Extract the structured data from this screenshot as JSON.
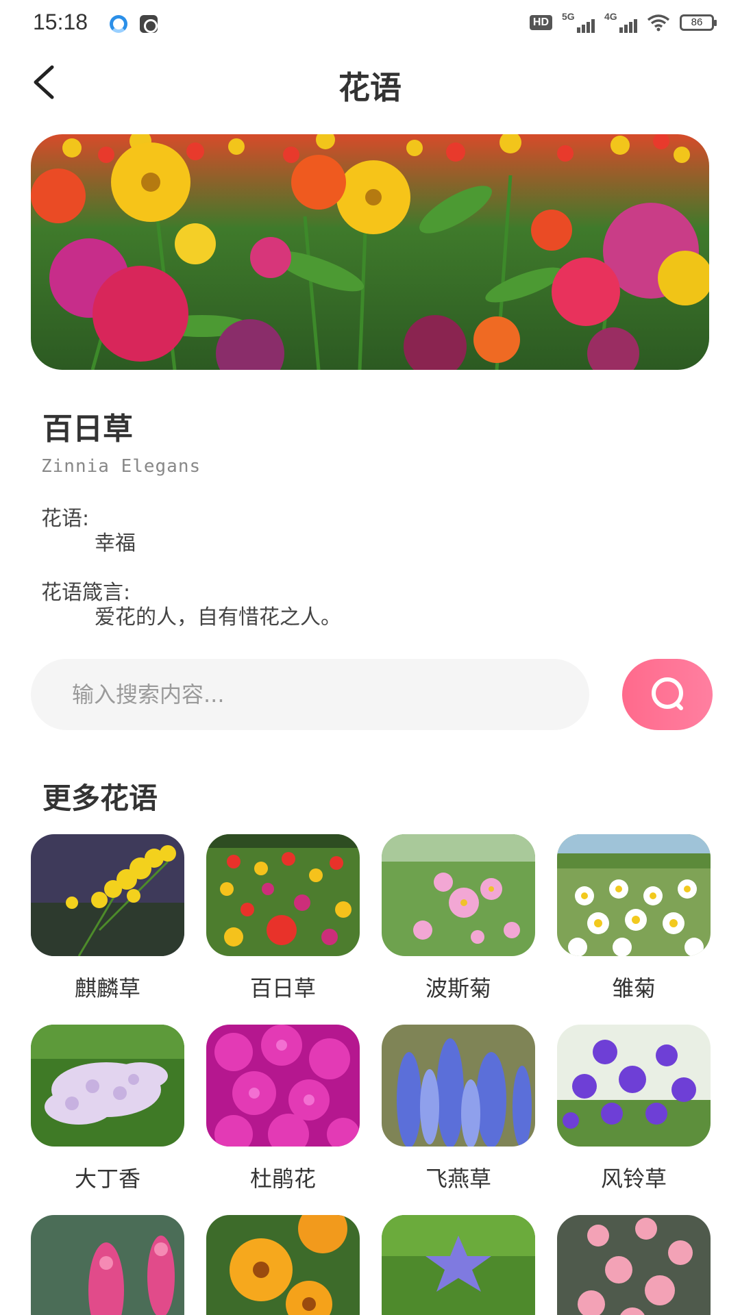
{
  "status_bar": {
    "time": "15:18",
    "hd_label": "HD",
    "net1": "5G",
    "net2": "4G",
    "battery": "86",
    "icons": [
      "wave-app-icon",
      "camera-app-icon",
      "hd-icon",
      "signal-5g-icon",
      "signal-4g-icon",
      "wifi-icon",
      "battery-icon"
    ]
  },
  "header": {
    "title": "花语",
    "back_icon": "chevron-left-icon"
  },
  "featured": {
    "name": "百日草",
    "latin": "Zinnia Elegans",
    "meaning_label": "花语:",
    "meaning": "幸福",
    "motto_label": "花语箴言:",
    "motto": "爱花的人，自有惜花之人。"
  },
  "search": {
    "placeholder": "输入搜索内容...",
    "value": "",
    "icon": "search-icon"
  },
  "more": {
    "title": "更多花语",
    "items": [
      {
        "label": "麒麟草"
      },
      {
        "label": "百日草"
      },
      {
        "label": "波斯菊"
      },
      {
        "label": "雏菊"
      },
      {
        "label": "大丁香"
      },
      {
        "label": "杜鹃花"
      },
      {
        "label": "飞燕草"
      },
      {
        "label": "风铃草"
      },
      {
        "label": ""
      },
      {
        "label": ""
      },
      {
        "label": ""
      },
      {
        "label": ""
      }
    ]
  },
  "colors": {
    "search_btn": "#ff7096",
    "search_bg": "#f5f5f5",
    "title_text": "#333333"
  }
}
